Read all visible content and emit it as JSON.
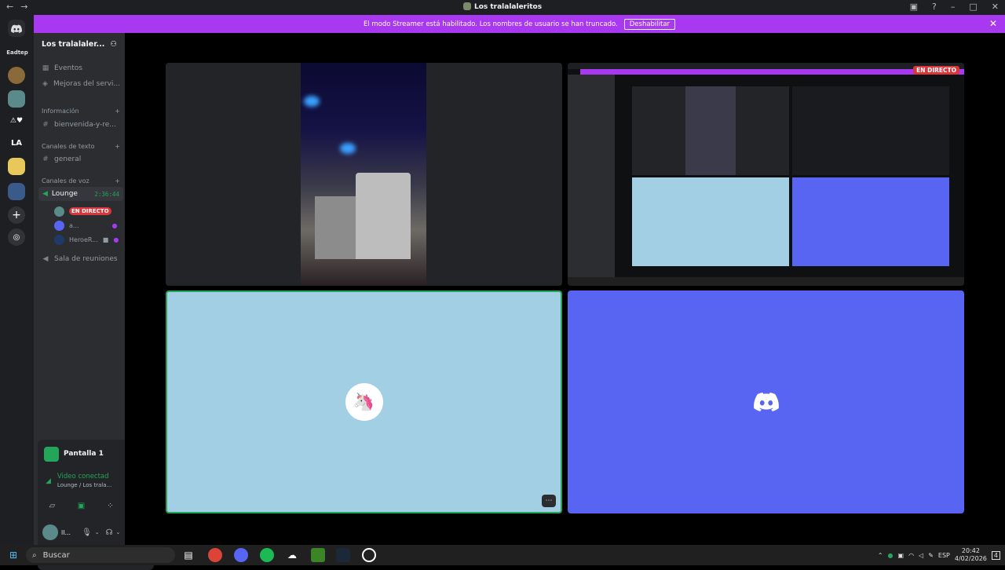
{
  "titlebar": {
    "title": "Los tralalaleritos",
    "back": "←",
    "forward": "→"
  },
  "banner": {
    "text": "El modo Streamer está habilitado. Los nombres de usuario se han truncado.",
    "button": "Deshabilitar",
    "close": "✕"
  },
  "rail": {
    "user_label": "Eadtep",
    "la_label": "LA"
  },
  "sidebar": {
    "server_name": "Los tralalaler...",
    "items": [
      {
        "label": "Eventos",
        "icon": "calendar-icon"
      },
      {
        "label": "Mejoras del servi...",
        "icon": "boost-icon"
      }
    ],
    "categories": [
      {
        "label": "Información",
        "channels": [
          "bienvenida-y-re..."
        ]
      },
      {
        "label": "Canales de texto",
        "channels": [
          "general"
        ]
      },
      {
        "label": "Canales de voz",
        "channels": [
          "Lounge",
          "Sala de reuniones"
        ]
      }
    ],
    "lounge_timer": "2:36:44",
    "voice_users": [
      {
        "name": "",
        "badge": "EN DIRECTO"
      },
      {
        "name": "a..."
      },
      {
        "name": "HeroeR..."
      }
    ]
  },
  "voice_panel": {
    "title": "Pantalla 1",
    "status": "Video conectad",
    "sub": "Lounge / Los trala...",
    "user_initials": "ll..."
  },
  "stage": {
    "live_tag": "EN DIRECTO",
    "more": "⋯"
  },
  "taskbar": {
    "search": "Buscar",
    "lang": "ESP",
    "time": "20:42",
    "date": "4/02/2026",
    "notif_count": "4"
  },
  "colors": {
    "banner": "#a839f0",
    "blurple": "#5865f2",
    "green": "#23a55a",
    "live": "#da373c",
    "tile_light": "#a2cfe3"
  }
}
